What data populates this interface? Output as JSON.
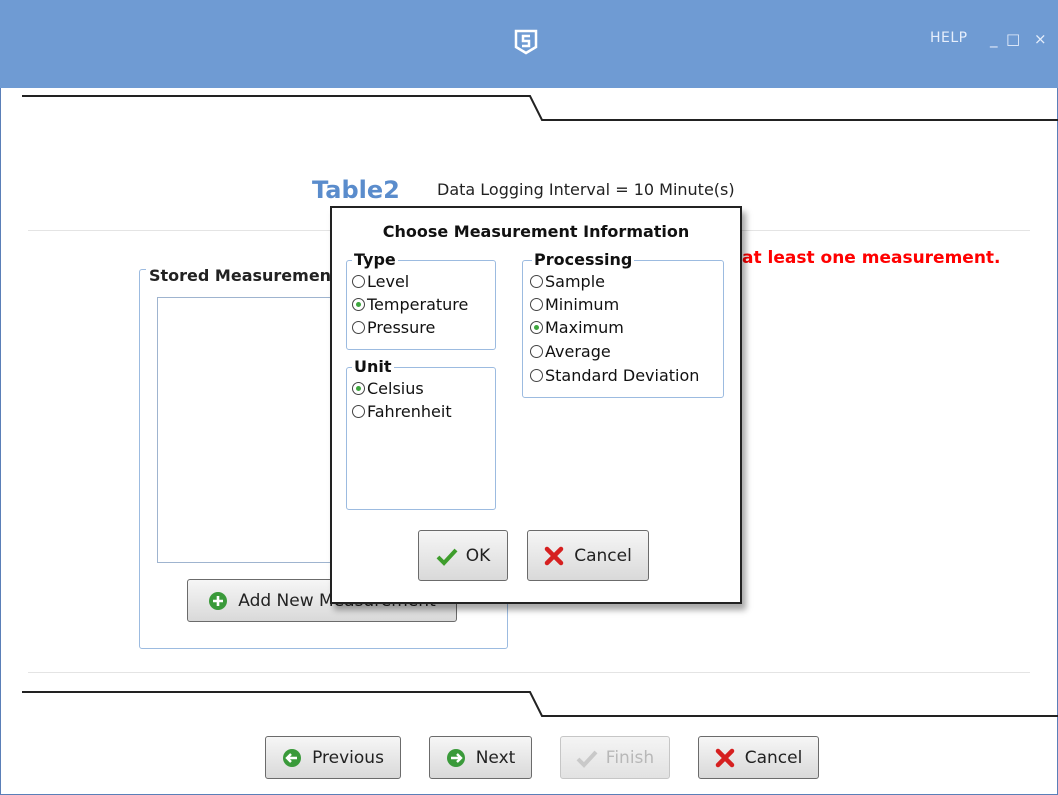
{
  "window": {
    "help_label": "HELP",
    "minimize_glyph": "_",
    "maximize_glyph": "□",
    "close_glyph": "×",
    "accent": "#6f9bd3"
  },
  "table": {
    "name": "Table2",
    "interval_text": "Data Logging Interval = 10 Minute(s)"
  },
  "warning": {
    "text": "at least one measurement.",
    "color": "#ff0000"
  },
  "stored": {
    "legend": "Stored Measurements",
    "add_label": "Add New Measurement"
  },
  "dialog": {
    "title": "Choose Measurement Information",
    "type": {
      "legend": "Type",
      "options": [
        {
          "label": "Level",
          "selected": false
        },
        {
          "label": "Temperature",
          "selected": true
        },
        {
          "label": "Pressure",
          "selected": false
        }
      ]
    },
    "unit": {
      "legend": "Unit",
      "options": [
        {
          "label": "Celsius",
          "selected": true
        },
        {
          "label": "Fahrenheit",
          "selected": false
        }
      ]
    },
    "processing": {
      "legend": "Processing",
      "options": [
        {
          "label": "Sample",
          "selected": false
        },
        {
          "label": "Minimum",
          "selected": false
        },
        {
          "label": "Maximum",
          "selected": true
        },
        {
          "label": "Average",
          "selected": false
        },
        {
          "label": "Standard Deviation",
          "selected": false
        }
      ]
    },
    "ok_label": "OK",
    "cancel_label": "Cancel"
  },
  "wizard": {
    "previous_label": "Previous",
    "next_label": "Next",
    "finish_label": "Finish",
    "finish_disabled": true,
    "cancel_label": "Cancel"
  },
  "icons": {
    "logo": "cs-logo-icon",
    "add": "plus-circle-icon",
    "ok": "checkmark-icon",
    "cancel": "red-x-icon",
    "previous": "arrow-left-circle-icon",
    "next": "arrow-right-circle-icon",
    "finish": "checkmark-icon"
  }
}
